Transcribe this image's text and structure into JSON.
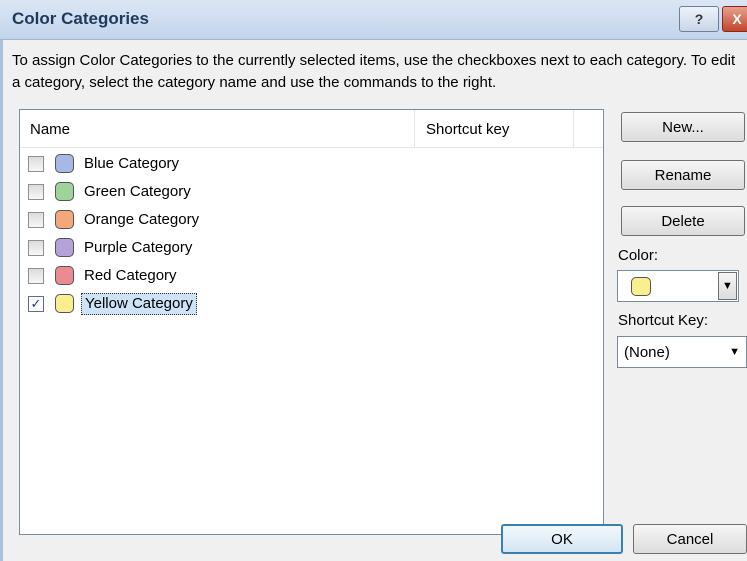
{
  "window": {
    "title": "Color Categories",
    "help_label": "?",
    "close_label": "X"
  },
  "instructions": "To assign Color Categories to the currently selected items, use the checkboxes next to each category.  To edit a category, select the category name and use the commands to the right.",
  "list": {
    "columns": [
      "Name",
      "Shortcut key"
    ],
    "items": [
      {
        "label": "Blue Category",
        "checked": false,
        "color": "#a8b8e6",
        "check_mark": ""
      },
      {
        "label": "Green Category",
        "checked": false,
        "color": "#9ed39a",
        "check_mark": ""
      },
      {
        "label": "Orange Category",
        "checked": false,
        "color": "#f5a77c",
        "check_mark": ""
      },
      {
        "label": "Purple Category",
        "checked": false,
        "color": "#b6a1d8",
        "check_mark": ""
      },
      {
        "label": "Red Category",
        "checked": false,
        "color": "#ec8a92",
        "check_mark": ""
      },
      {
        "label": "Yellow Category",
        "checked": true,
        "color": "#fbee8f",
        "check_mark": "✓",
        "selected": true
      }
    ]
  },
  "buttons": {
    "new": "New...",
    "rename": "Rename",
    "delete": "Delete",
    "ok": "OK",
    "cancel": "Cancel"
  },
  "color": {
    "label": "Color:",
    "value": "#fbee8f",
    "dropdown_icon": "▼"
  },
  "shortcut": {
    "label": "Shortcut Key:",
    "value": "(None)",
    "dropdown_icon": "▼"
  }
}
